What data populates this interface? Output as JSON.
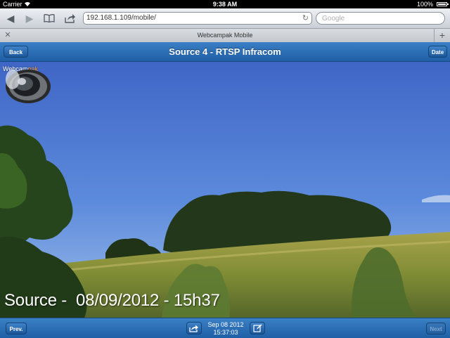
{
  "status_bar": {
    "carrier": "Carrier",
    "time": "9:38 AM",
    "battery": "100%"
  },
  "browser": {
    "url": "192.168.1.109/mobile/",
    "search_placeholder": "Google",
    "tab_title": "Webcampak Mobile",
    "icons": [
      "back-arrow-icon",
      "forward-arrow-icon",
      "bookmarks-icon",
      "share-icon",
      "reload-icon",
      "close-icon",
      "plus-icon"
    ]
  },
  "header": {
    "back_label": "Back",
    "title": "Source 4 - RTSP Infracom",
    "date_label": "Date"
  },
  "camera": {
    "overlay": "Source -  08/09/2012 - 15h37",
    "brand_prefix": "Webcam",
    "brand_suffix": "pak"
  },
  "footer": {
    "prev_label": "Prev.",
    "date": "Sep 08 2012",
    "time": "15:37:03",
    "next_label": "Next"
  },
  "colors": {
    "header_blue": "#2a6db5",
    "brand_orange": "#f29a3a",
    "sky_top": "#3c68c8",
    "sky_bottom": "#8fb4e8"
  }
}
